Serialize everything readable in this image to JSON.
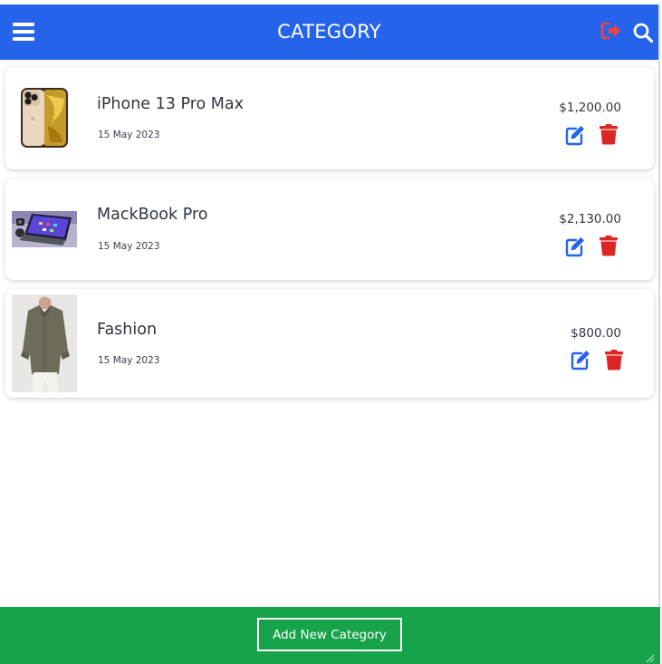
{
  "header": {
    "title": "CATEGORY",
    "menu_icon": "hamburger-menu-icon",
    "logout_icon": "logout-icon",
    "search_icon": "search-icon",
    "colors": {
      "background": "#2563eb",
      "logout": "#ef4444",
      "text": "#ffffff"
    }
  },
  "items": [
    {
      "name": "iPhone 13 Pro Max",
      "date": "15 May 2023",
      "price": "$1,200.00",
      "thumbnail": "iphone-13-pro-max-image"
    },
    {
      "name": "MackBook Pro",
      "date": "15 May 2023",
      "price": "$2,130.00",
      "thumbnail": "macbook-pro-image"
    },
    {
      "name": "Fashion",
      "date": "15 May 2023",
      "price": "$800.00",
      "thumbnail": "fashion-shirt-image"
    }
  ],
  "actions": {
    "edit_icon": "edit-icon",
    "delete_icon": "trash-icon",
    "edit_color": "#2563eb",
    "delete_color": "#dc2626"
  },
  "footer": {
    "add_label": "Add New Category",
    "background": "#16a34a"
  }
}
